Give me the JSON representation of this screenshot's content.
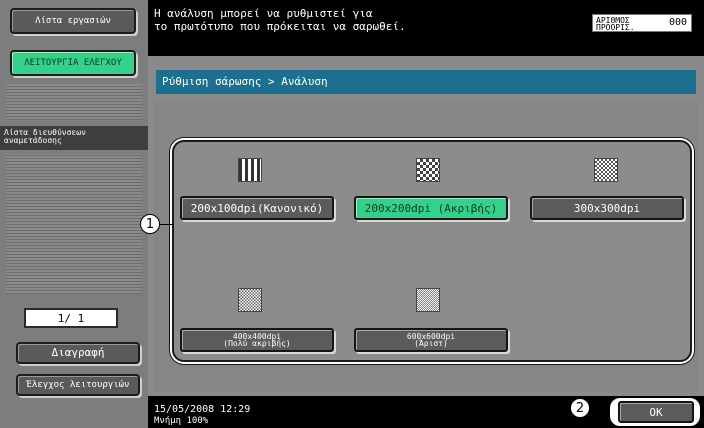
{
  "left": {
    "job_list_label": "Λίστα εργασιών",
    "control_function_label": "ΛΕΙΤΟΥΡΓΙΑ ΕΛΕΓΧΟΥ",
    "address_list_label": "Λίστα διευθύνσεων αναμετάδοσης",
    "page_indicator": "1/ 1",
    "delete_label": "Διαγραφή",
    "check_functions_label": "Έλεγχος λειτουργιών"
  },
  "top": {
    "message_line1": "Η ανάλυση μπορεί να ρυθμιστεί για",
    "message_line2": "το πρωτότυπο που πρόκειται να σαρωθεί.",
    "counter_label_1": "ΑΡΙΘΜΟΣ",
    "counter_label_2": "ΠΡΟΟΡΙΣ.",
    "counter_value": "000"
  },
  "main": {
    "breadcrumb": "Ρύθμιση σάρωσης > Ανάλυση",
    "options": [
      {
        "label": "200x100dpi(Κανονικό)",
        "selected": false,
        "icon": "resolution-pattern-icon"
      },
      {
        "label": "200x200dpi (Ακριβής)",
        "selected": true,
        "icon": "resolution-pattern-icon"
      },
      {
        "label": "300x300dpi",
        "selected": false,
        "icon": "resolution-pattern-icon"
      },
      {
        "label_1": "400x400dpi",
        "label_2": "(Πολύ ακριβής)",
        "selected": false,
        "icon": "resolution-pattern-icon"
      },
      {
        "label_1": "600x600dpi",
        "label_2": "(Άριστ)",
        "selected": false,
        "icon": "resolution-pattern-icon"
      }
    ]
  },
  "callouts": {
    "one": "1",
    "two": "2"
  },
  "bottom": {
    "datetime": "15/05/2008   12:29",
    "memory": "Μνήμη      100%",
    "ok_label": "OK"
  },
  "colors": {
    "selected_green": "#33d18a",
    "breadcrumb_blue": "#1d6f8f",
    "button_gray": "#5b5b5b"
  }
}
